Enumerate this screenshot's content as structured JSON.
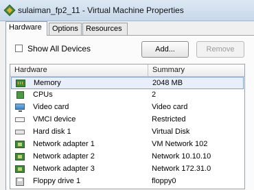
{
  "window": {
    "title": "sulaiman_fp2_11 - Virtual Machine Properties",
    "icon": "vm-icon"
  },
  "tabs": [
    {
      "label": "Hardware",
      "active": true
    },
    {
      "label": "Options",
      "active": false
    },
    {
      "label": "Resources",
      "active": false
    }
  ],
  "controls": {
    "show_all_label": "Show All Devices",
    "show_all_checked": false,
    "add_label": "Add...",
    "remove_label": "Remove",
    "remove_enabled": false
  },
  "table": {
    "columns": [
      "Hardware",
      "Summary"
    ],
    "rows": [
      {
        "icon": "memory-icon",
        "name": "Memory",
        "summary": "2048 MB",
        "selected": true
      },
      {
        "icon": "cpu-icon",
        "name": "CPUs",
        "summary": "2"
      },
      {
        "icon": "video-card-icon",
        "name": "Video card",
        "summary": "Video card"
      },
      {
        "icon": "vmci-device-icon",
        "name": "VMCI device",
        "summary": "Restricted"
      },
      {
        "icon": "hard-disk-icon",
        "name": "Hard disk 1",
        "summary": "Virtual Disk"
      },
      {
        "icon": "network-adapter-icon",
        "name": "Network adapter 1",
        "summary": "VM Network 102"
      },
      {
        "icon": "network-adapter-icon",
        "name": "Network adapter 2",
        "summary": "Network 10.10.10"
      },
      {
        "icon": "network-adapter-icon",
        "name": "Network adapter 3",
        "summary": "Network 172.31.0"
      },
      {
        "icon": "floppy-drive-icon",
        "name": "Floppy drive 1",
        "summary": "floppy0"
      }
    ]
  }
}
